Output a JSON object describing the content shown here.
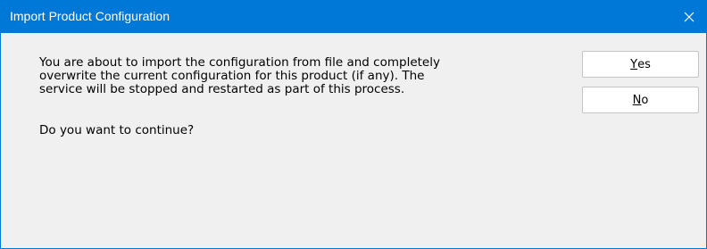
{
  "window": {
    "title": "Import Product Configuration",
    "close_icon": "close-icon",
    "titlebar_color": "#0078d7"
  },
  "message": {
    "lines": [
      "You are about to import the configuration from file and completely",
      "overwrite the current configuration for this product (if any).  The",
      "service will be stopped and restarted as part of this process."
    ],
    "question": "Do you want to continue?"
  },
  "buttons": {
    "yes": {
      "mnemonic": "Y",
      "rest": "es"
    },
    "no": {
      "mnemonic": "N",
      "rest": "o"
    }
  }
}
